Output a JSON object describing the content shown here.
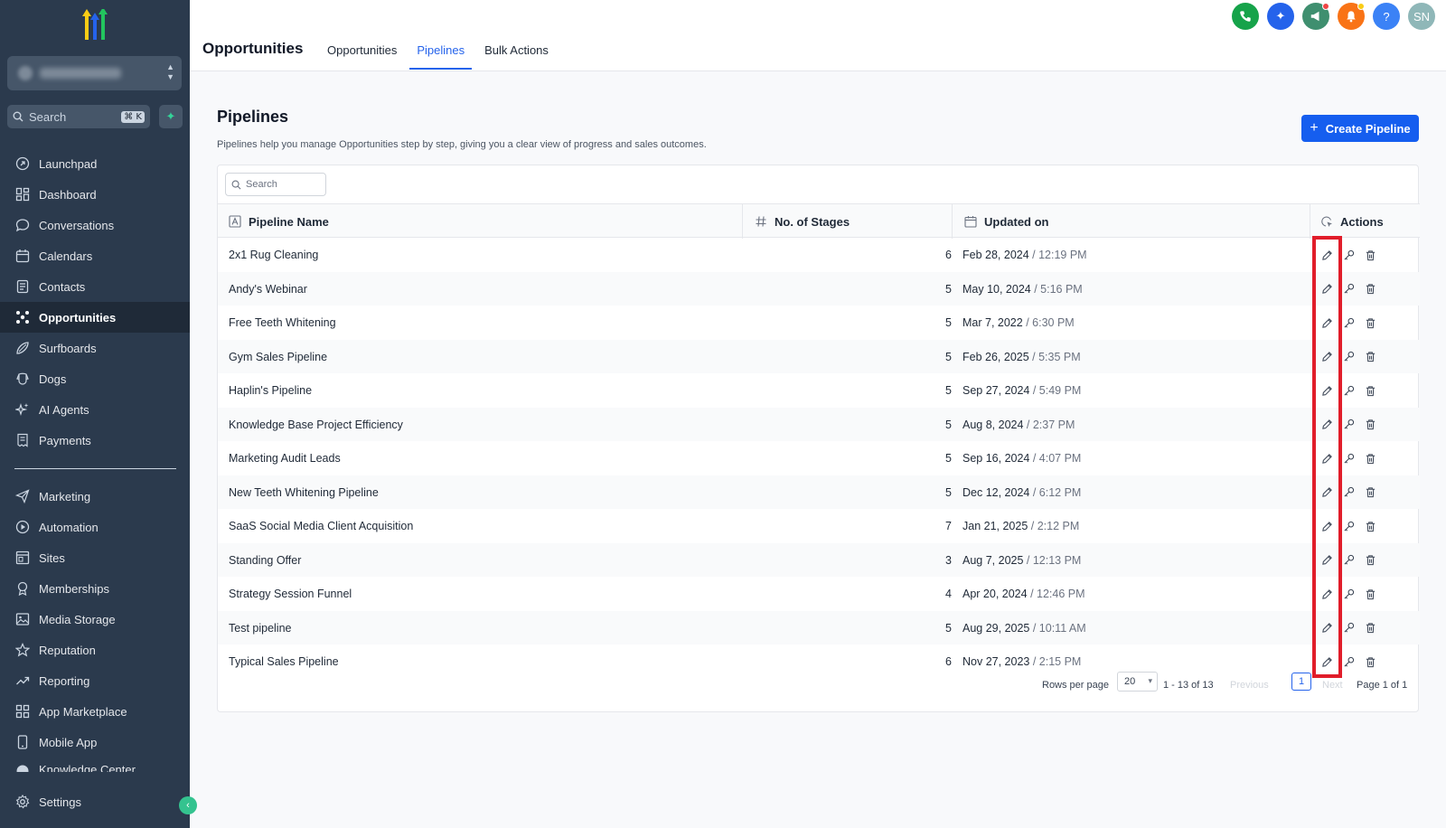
{
  "sidebar": {
    "search_placeholder": "Search",
    "search_shortcut": "⌘ K",
    "nav_primary": [
      {
        "label": "Launchpad",
        "icon": "rocket-icon"
      },
      {
        "label": "Dashboard",
        "icon": "dashboard-icon"
      },
      {
        "label": "Conversations",
        "icon": "chat-icon"
      },
      {
        "label": "Calendars",
        "icon": "calendar-icon"
      },
      {
        "label": "Contacts",
        "icon": "contacts-icon"
      },
      {
        "label": "Opportunities",
        "icon": "opportunities-icon",
        "active": true
      },
      {
        "label": "Surfboards",
        "icon": "surfboard-icon"
      },
      {
        "label": "Dogs",
        "icon": "dog-icon"
      },
      {
        "label": "AI Agents",
        "icon": "sparkle-icon"
      },
      {
        "label": "Payments",
        "icon": "receipt-icon"
      }
    ],
    "nav_secondary": [
      {
        "label": "Marketing",
        "icon": "send-icon"
      },
      {
        "label": "Automation",
        "icon": "automation-icon"
      },
      {
        "label": "Sites",
        "icon": "sites-icon"
      },
      {
        "label": "Memberships",
        "icon": "award-icon"
      },
      {
        "label": "Media Storage",
        "icon": "image-icon"
      },
      {
        "label": "Reputation",
        "icon": "star-icon"
      },
      {
        "label": "Reporting",
        "icon": "trend-icon"
      },
      {
        "label": "App Marketplace",
        "icon": "grid-icon"
      },
      {
        "label": "Mobile App",
        "icon": "mobile-icon"
      },
      {
        "label": "Knowledge Center",
        "icon": "book-icon"
      }
    ],
    "settings_label": "Settings"
  },
  "topbar": {
    "title": "Opportunities",
    "tabs": [
      {
        "label": "Opportunities",
        "active": false
      },
      {
        "label": "Pipelines",
        "active": true
      },
      {
        "label": "Bulk Actions",
        "active": false
      }
    ],
    "icons": [
      {
        "name": "phone-icon",
        "color": "#16a34a"
      },
      {
        "name": "ai-sparkle-icon",
        "color": "#2563eb"
      },
      {
        "name": "megaphone-icon",
        "color": "#3f8f6f"
      },
      {
        "name": "bell-icon",
        "color": "#f97316"
      },
      {
        "name": "help-icon",
        "color": "#3b82f6"
      },
      {
        "name": "avatar",
        "color": "#8fb7b8",
        "text": "SN"
      }
    ]
  },
  "main": {
    "title": "Pipelines",
    "description": "Pipelines help you manage Opportunities step by step, giving you a clear view of progress and sales outcomes.",
    "create_button": "Create Pipeline",
    "search_placeholder": "Search",
    "columns": [
      "Pipeline Name",
      "No. of Stages",
      "Updated on",
      "Actions"
    ],
    "rows": [
      {
        "name": "2x1 Rug Cleaning",
        "stages": "6",
        "date": "Feb 28, 2024",
        "time": "12:19 PM"
      },
      {
        "name": "Andy's Webinar",
        "stages": "5",
        "date": "May 10, 2024",
        "time": "5:16 PM"
      },
      {
        "name": "Free Teeth Whitening",
        "stages": "5",
        "date": "Mar 7, 2022",
        "time": "6:30 PM"
      },
      {
        "name": "Gym Sales Pipeline",
        "stages": "5",
        "date": "Feb 26, 2025",
        "time": "5:35 PM"
      },
      {
        "name": "Haplin's Pipeline",
        "stages": "5",
        "date": "Sep 27, 2024",
        "time": "5:49 PM"
      },
      {
        "name": "Knowledge Base Project Efficiency",
        "stages": "5",
        "date": "Aug 8, 2024",
        "time": "2:37 PM"
      },
      {
        "name": "Marketing Audit Leads",
        "stages": "5",
        "date": "Sep 16, 2024",
        "time": "4:07 PM"
      },
      {
        "name": "New Teeth Whitening Pipeline",
        "stages": "5",
        "date": "Dec 12, 2024",
        "time": "6:12 PM"
      },
      {
        "name": "SaaS Social Media Client Acquisition",
        "stages": "7",
        "date": "Jan 21, 2025",
        "time": "2:12 PM"
      },
      {
        "name": "Standing Offer",
        "stages": "3",
        "date": "Aug 7, 2025",
        "time": "12:13 PM"
      },
      {
        "name": "Strategy Session Funnel",
        "stages": "4",
        "date": "Apr 20, 2024",
        "time": "12:46 PM"
      },
      {
        "name": "Test pipeline",
        "stages": "5",
        "date": "Aug 29, 2025",
        "time": "10:11 AM"
      },
      {
        "name": "Typical Sales Pipeline",
        "stages": "6",
        "date": "Nov 27, 2023",
        "time": "2:15 PM"
      }
    ],
    "pagination": {
      "rows_per_page_label": "Rows per page",
      "rows_per_page": "20",
      "range": "1 - 13 of 13",
      "prev": "Previous",
      "page": "1",
      "next": "Next",
      "page_of": "Page 1 of 1"
    }
  },
  "colors": {
    "sidebar_bg": "#2b3a4d",
    "accent": "#155eef",
    "highlight_box": "#e11d2a"
  }
}
